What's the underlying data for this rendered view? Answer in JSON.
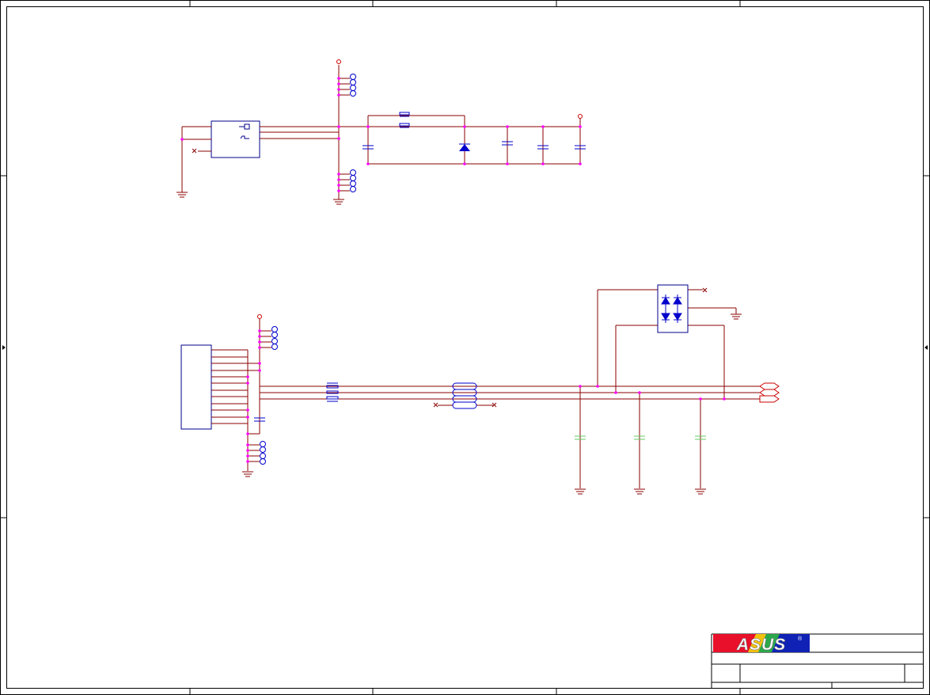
{
  "title_block": {
    "logo_text": "ASUS",
    "logo_mark": "®"
  },
  "colors": {
    "frame": "#000000",
    "wire": "#8b0000",
    "junction": "#ff00ff",
    "component": "#0000cc",
    "power_rail": "#cc0000",
    "filter_cap": "#66cc66",
    "logo_red": "#e8102a",
    "logo_blue": "#1022b5"
  },
  "icons": {
    "ground": "ground-icon",
    "power": "power-port-icon",
    "no_connect": "no-connect-icon",
    "mounting_pad": "mounting-pad-icon",
    "diode": "diode-icon",
    "capacitor": "capacitor-icon"
  }
}
